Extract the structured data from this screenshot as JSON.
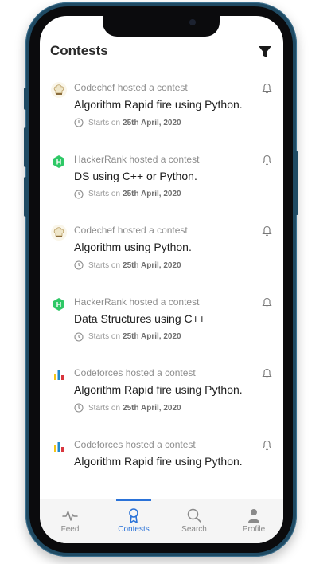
{
  "header": {
    "title": "Contests"
  },
  "contests": [
    {
      "host": "Codechef hosted a contest",
      "title": "Algorithm Rapid fire using Python.",
      "starts_prefix": "Starts on",
      "date": "25th April, 2020",
      "logo": "chef-hat-icon"
    },
    {
      "host": "HackerRank hosted a contest",
      "title": "DS using C++ or Python.",
      "starts_prefix": "Starts on",
      "date": "25th April, 2020",
      "logo": "hackerrank-h-icon"
    },
    {
      "host": "Codechef hosted a contest",
      "title": "Algorithm using Python.",
      "starts_prefix": "Starts on",
      "date": "25th April, 2020",
      "logo": "chef-hat-icon"
    },
    {
      "host": "HackerRank hosted a contest",
      "title": "Data Structures using C++",
      "starts_prefix": "Starts on",
      "date": "25th April, 2020",
      "logo": "hackerrank-h-icon"
    },
    {
      "host": "Codeforces hosted a contest",
      "title": "Algorithm Rapid fire using Python.",
      "starts_prefix": "Starts on",
      "date": "25th April, 2020",
      "logo": "codeforces-bars-icon"
    },
    {
      "host": "Codeforces hosted a contest",
      "title": "Algorithm Rapid fire using Python.",
      "logo": "codeforces-bars-icon"
    }
  ],
  "nav": {
    "feed": "Feed",
    "contests": "Contests",
    "search": "Search",
    "profile": "Profile",
    "active": "contests"
  },
  "colors": {
    "accent": "#2a72d8",
    "hackerrank_green": "#2ec866",
    "frame": "#1f4a63"
  }
}
